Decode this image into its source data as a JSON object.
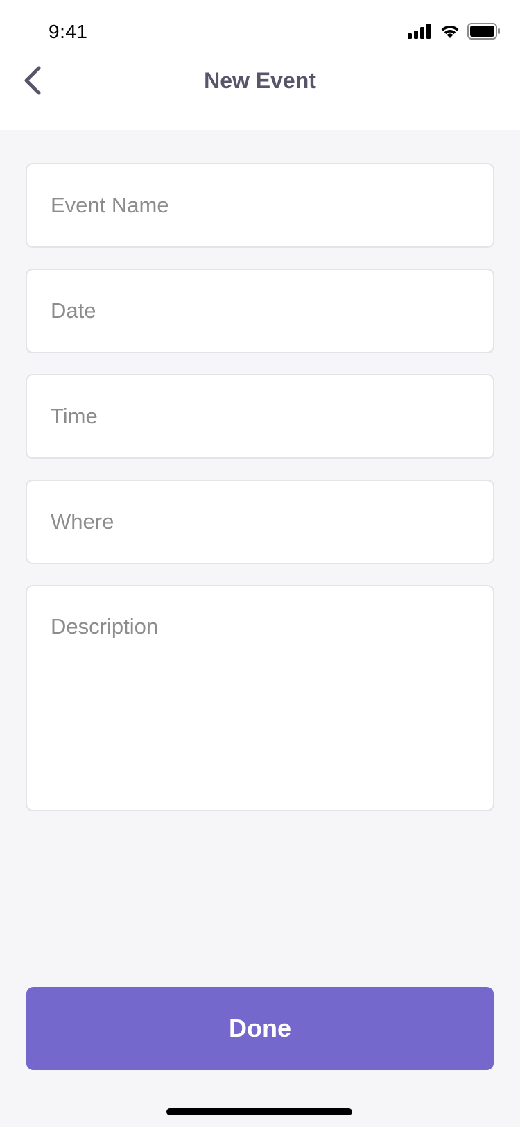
{
  "status_bar": {
    "time": "9:41",
    "icons": [
      "cellular-signal-icon",
      "wifi-icon",
      "battery-icon"
    ]
  },
  "nav": {
    "back_icon": "chevron-left-icon",
    "title": "New Event"
  },
  "form": {
    "event_name": {
      "value": "",
      "placeholder": "Event Name"
    },
    "date": {
      "value": "",
      "placeholder": "Date"
    },
    "time": {
      "value": "",
      "placeholder": "Time"
    },
    "where": {
      "value": "",
      "placeholder": "Where"
    },
    "description": {
      "value": "",
      "placeholder": "Description"
    }
  },
  "actions": {
    "done_label": "Done"
  },
  "colors": {
    "background": "#f6f6f9",
    "header_background": "#ffffff",
    "title_text": "#565569",
    "placeholder_text": "#8c8c8c",
    "field_border": "#e3e3e8",
    "accent": "#7468cd",
    "button_text": "#ffffff"
  }
}
